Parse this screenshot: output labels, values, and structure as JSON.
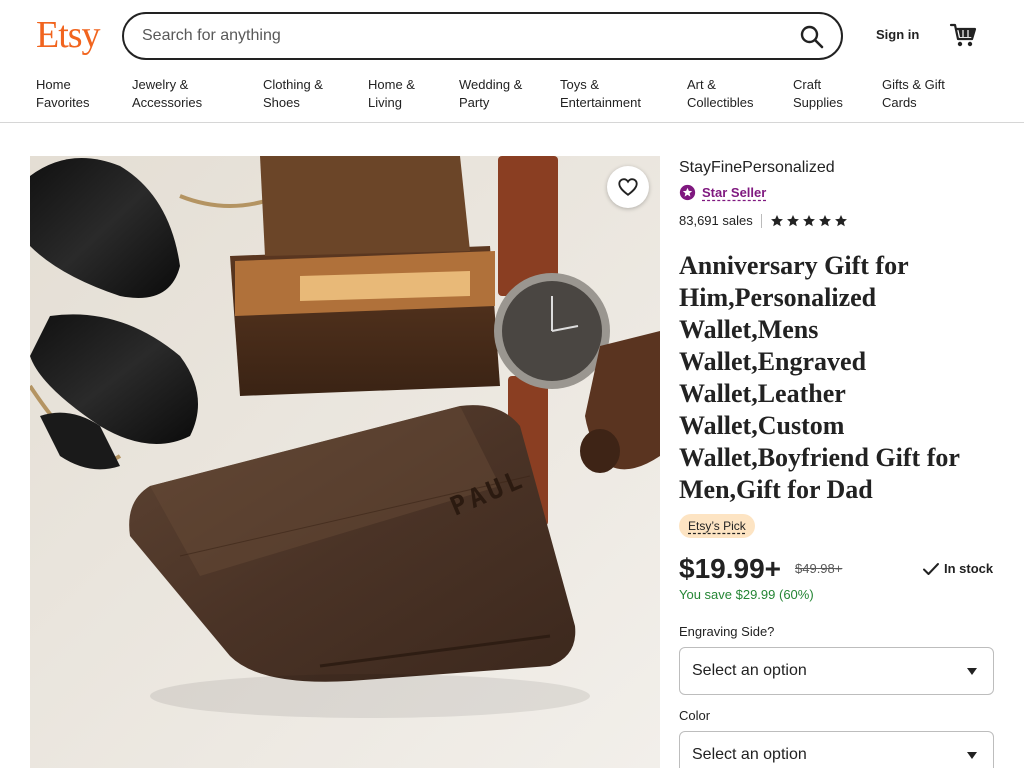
{
  "header": {
    "logo": "Etsy",
    "search_placeholder": "Search for anything",
    "sign_in": "Sign in"
  },
  "categories": [
    "Home\nFavorites",
    "Jewelry &\nAccessories",
    "Clothing &\nShoes",
    "Home &\nLiving",
    "Wedding &\nParty",
    "Toys &\nEntertainment",
    "Art &\nCollectibles",
    "Craft\nSupplies",
    "Gifts & Gift\nCards"
  ],
  "listing": {
    "shop_name": "StayFinePersonalized",
    "star_seller": "Star Seller",
    "sales": "83,691 sales",
    "rating_stars": 5,
    "title": "Anniversary Gift for Him,Personalized Wallet,Mens Wallet,Engraved Wallet,Leather Wallet,Custom Wallet,Boyfriend Gift for Men,Gift for Dad",
    "badge": "Etsy’s Pick",
    "price": "$19.99+",
    "original_price": "$49.98+",
    "stock": "In stock",
    "savings": "You save $29.99 (60%)",
    "engraving_label": "Engraving Side?",
    "engraving_value": "Select an option",
    "color_label": "Color",
    "color_value": "Select an option",
    "photo_engraving": "PAUL"
  },
  "colors": {
    "brand_orange": "#F1641E",
    "star_seller_purple": "#7F187F",
    "savings_green": "#258635",
    "pick_badge_bg": "#FDE4C3"
  }
}
